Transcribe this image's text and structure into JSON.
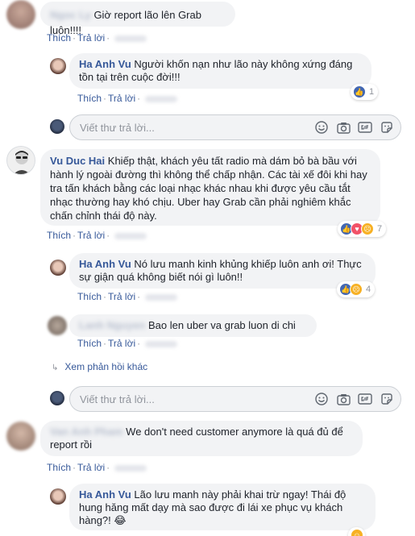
{
  "actions": {
    "like": "Thích",
    "reply": "Trả lời",
    "dot": "·"
  },
  "write_placeholder": "Viết thư trả lời...",
  "comment1": {
    "text": "Giờ report lão lên Grab luôn!!!!",
    "blurred_name": "Ngoc Ly"
  },
  "reply1": {
    "name": "Ha Anh Vu",
    "text": "Người khốn nạn như lão này không xứng đáng tồn tại trên cuộc đời!!!",
    "reaction_count": "1"
  },
  "comment2": {
    "name": "Vu Duc Hai",
    "text": "Khiếp thật, khách yêu tất radio mà dám bỏ bà bầu với hành lý ngoài đường thì không thể chấp nhận. Các tài xế đôi khi hay tra tấn khách bằng các loại nhạc khác nhau khi được yêu cầu tắt nhạc thường hay khó chịu. Uber hay Grab cần phải nghiêm khắc chấn chỉnh thái độ này.",
    "reaction_count": "7"
  },
  "reply2": {
    "name": "Ha Anh Vu",
    "text": "Nó lưu manh kinh khủng khiếp luôn anh ơi! Thực sự giận quá không biết nói gì luôn!!",
    "reaction_count": "4"
  },
  "reply3": {
    "blurred_name": "Lanh Nguyen",
    "text": "Bao len uber va grab luon di chi"
  },
  "more_replies": "Xem phản hồi khác",
  "comment3": {
    "blurred_name": "Van Anh Pham",
    "text": "We don't need customer anymore là quá đủ để report rồi"
  },
  "reply4": {
    "name": "Ha Anh Vu",
    "text": "Lão lưu manh này phải khai trừ ngay! Thái độ hung hăng mất dạy mà sao được đi lái xe phục vụ khách hàng?! 😂"
  },
  "colors": {
    "link": "#365899",
    "bubble": "#f2f3f5",
    "like": "#4267b2",
    "love": "#f25268",
    "sad": "#f7b125"
  }
}
